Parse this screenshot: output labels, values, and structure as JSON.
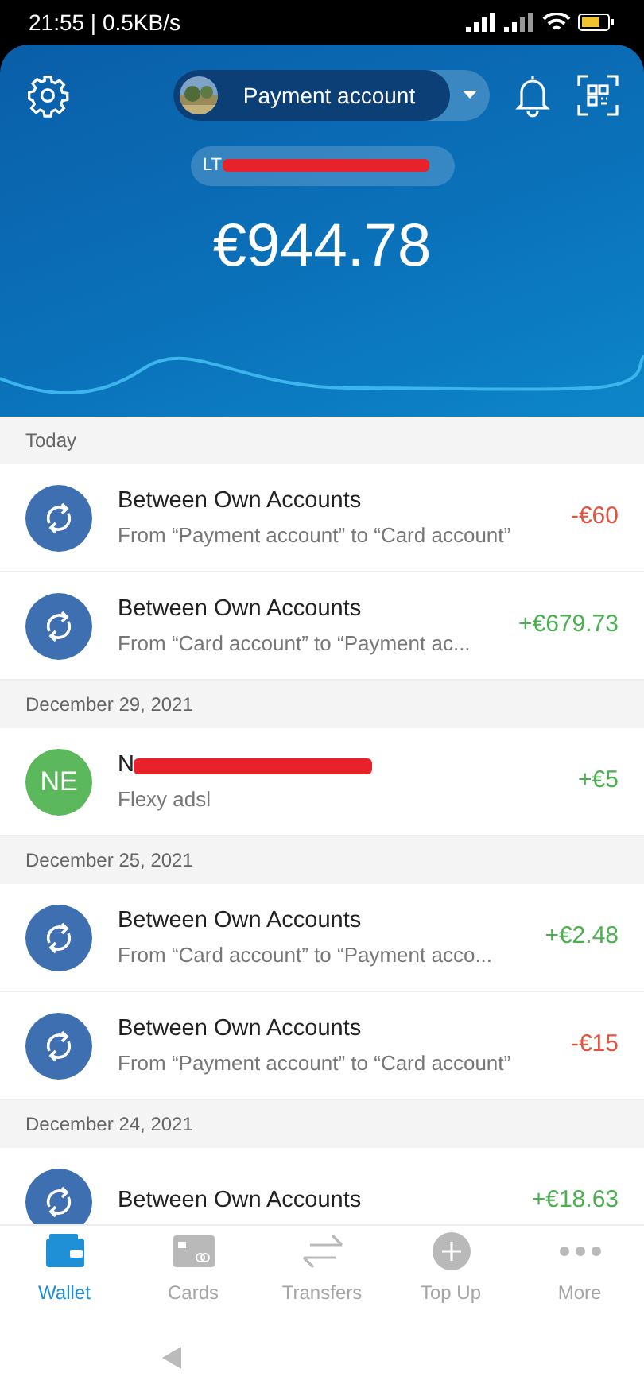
{
  "status_bar": {
    "time": "21:55 | 0.5KB/s"
  },
  "header": {
    "account": "Payment account",
    "iban": "LT",
    "balance": "€944.78"
  },
  "sections": [
    {
      "date": "Today",
      "transactions": [
        {
          "kind": "transfer",
          "title": "Between Own Accounts",
          "subtitle": "From “Payment account” to “Card account”",
          "amount": "-€60",
          "color": "#e0533f"
        },
        {
          "kind": "transfer",
          "title": "Between Own Accounts",
          "subtitle": "From “Card account” to “Payment ac...",
          "amount": "+€679.73",
          "color": "#4caf50"
        }
      ]
    },
    {
      "date": "December 29, 2021",
      "transactions": [
        {
          "kind": "person",
          "initials": "NE",
          "title": "N",
          "subtitle": "Flexy adsl",
          "amount": "+€5",
          "color": "#4caf50"
        }
      ]
    },
    {
      "date": "December 25, 2021",
      "transactions": [
        {
          "kind": "transfer",
          "title": "Between Own Accounts",
          "subtitle": "From “Card account” to “Payment acco...",
          "amount": "+€2.48",
          "color": "#4caf50"
        },
        {
          "kind": "transfer",
          "title": "Between Own Accounts",
          "subtitle": "From “Payment account” to “Card account”",
          "amount": "-€15",
          "color": "#e0533f"
        }
      ]
    },
    {
      "date": "December 24, 2021",
      "transactions": [
        {
          "kind": "transfer",
          "title": "Between Own Accounts",
          "amount": "+€18.63",
          "color": "#4caf50"
        }
      ]
    }
  ],
  "nav": [
    {
      "label": "Wallet",
      "selected": true
    },
    {
      "label": "Cards",
      "selected": false
    },
    {
      "label": "Transfers",
      "selected": false
    },
    {
      "label": "Top Up",
      "selected": false
    },
    {
      "label": "More",
      "selected": false
    }
  ]
}
